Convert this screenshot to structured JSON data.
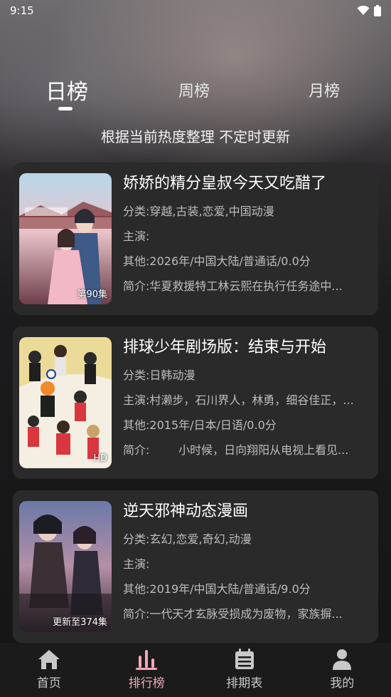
{
  "status_bar": {
    "time": "9:15"
  },
  "tabs": [
    {
      "label": "日榜",
      "active": true
    },
    {
      "label": "周榜",
      "active": false
    },
    {
      "label": "月榜",
      "active": false
    }
  ],
  "subtitle": "根据当前热度整理 不定时更新",
  "items": [
    {
      "title": "娇娇的精分皇叔今天又吃醋了",
      "badge": "第90集",
      "category_label": "分类:",
      "category": "穿越,古装,恋爱,中国动漫",
      "cast_label": "主演:",
      "cast": "",
      "other_label": "其他:",
      "other": "2026年/中国大陆/普通话/0.0分",
      "intro_label": "简介:",
      "intro": "华夏救援特工林云熙在执行任务途中..."
    },
    {
      "title": "排球少年剧场版：结束与开始",
      "badge": "HD",
      "category_label": "分类:",
      "category": "日韩动漫",
      "cast_label": "主演:",
      "cast": "村濑步，石川界人，林勇，细谷佳正，...",
      "other_label": "其他:",
      "other": "2015年/日本/日语/0.0分",
      "intro_label": "简介:",
      "intro": "        小时候，日向翔阳从电视上看见..."
    },
    {
      "title": "逆天邪神动态漫画",
      "badge": "更新至374集",
      "category_label": "分类:",
      "category": "玄幻,恋爱,奇幻,动漫",
      "cast_label": "主演:",
      "cast": "",
      "other_label": "其他:",
      "other": "2019年/中国大陆/普通话/9.0分",
      "intro_label": "简介:",
      "intro": "一代天才玄脉受损成为废物，家族摒..."
    }
  ],
  "bottom_nav": [
    {
      "label": "首页",
      "icon": "home-icon",
      "active": false
    },
    {
      "label": "排行榜",
      "icon": "bar-chart-icon",
      "active": true
    },
    {
      "label": "排期表",
      "icon": "calendar-icon",
      "active": false
    },
    {
      "label": "我的",
      "icon": "user-icon",
      "active": false
    }
  ],
  "colors": {
    "accent": "#f4a7b9",
    "card_bg": "#2a2a2a",
    "nav_bg": "#1b1b1b"
  }
}
